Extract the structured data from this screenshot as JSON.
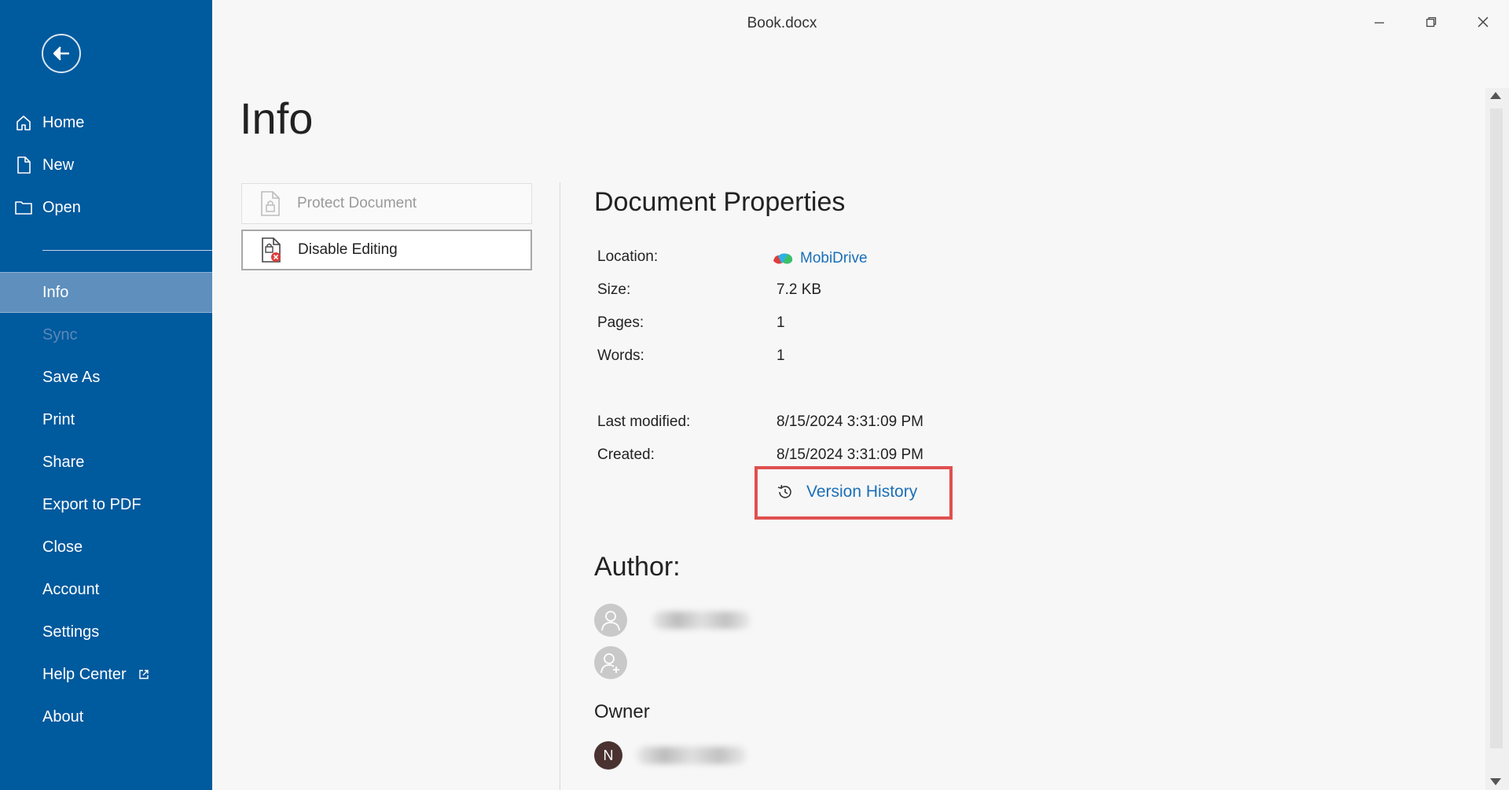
{
  "window": {
    "title": "Book.docx",
    "controls": {
      "minimize": "—",
      "maximize": "□",
      "close": "✕"
    }
  },
  "sidebar": {
    "items": [
      {
        "id": "home",
        "label": "Home",
        "icon": "home-icon"
      },
      {
        "id": "new",
        "label": "New",
        "icon": "new-document-icon"
      },
      {
        "id": "open",
        "label": "Open",
        "icon": "folder-icon"
      },
      {
        "id": "info",
        "label": "Info",
        "active": true
      },
      {
        "id": "sync",
        "label": "Sync",
        "disabled": true
      },
      {
        "id": "save-as",
        "label": "Save As"
      },
      {
        "id": "print",
        "label": "Print"
      },
      {
        "id": "share",
        "label": "Share"
      },
      {
        "id": "export-pdf",
        "label": "Export to PDF"
      },
      {
        "id": "close",
        "label": "Close"
      },
      {
        "id": "account",
        "label": "Account"
      },
      {
        "id": "settings",
        "label": "Settings"
      },
      {
        "id": "help-center",
        "label": "Help Center",
        "icon": "external-link-icon"
      },
      {
        "id": "about",
        "label": "About"
      }
    ]
  },
  "main": {
    "title": "Info",
    "actions": {
      "protect": "Protect Document",
      "disable_editing": "Disable Editing"
    },
    "properties": {
      "title": "Document Properties",
      "location_label": "Location:",
      "location_value": "MobiDrive",
      "size_label": "Size:",
      "size_value": "7.2 KB",
      "pages_label": "Pages:",
      "pages_value": "1",
      "words_label": "Words:",
      "words_value": "1",
      "modified_label": "Last modified:",
      "modified_value": "8/15/2024 3:31:09 PM",
      "created_label": "Created:",
      "created_value": "8/15/2024 3:31:09 PM",
      "version_history": "Version History"
    },
    "author": {
      "title": "Author:"
    },
    "owner": {
      "title": "Owner",
      "initial": "N"
    }
  },
  "colors": {
    "sidebar_bg": "#005a9e",
    "sidebar_active": "#5e8fbd",
    "link": "#1a6fb8",
    "highlight_box": "#e05050",
    "owner_avatar": "#4a3230"
  }
}
